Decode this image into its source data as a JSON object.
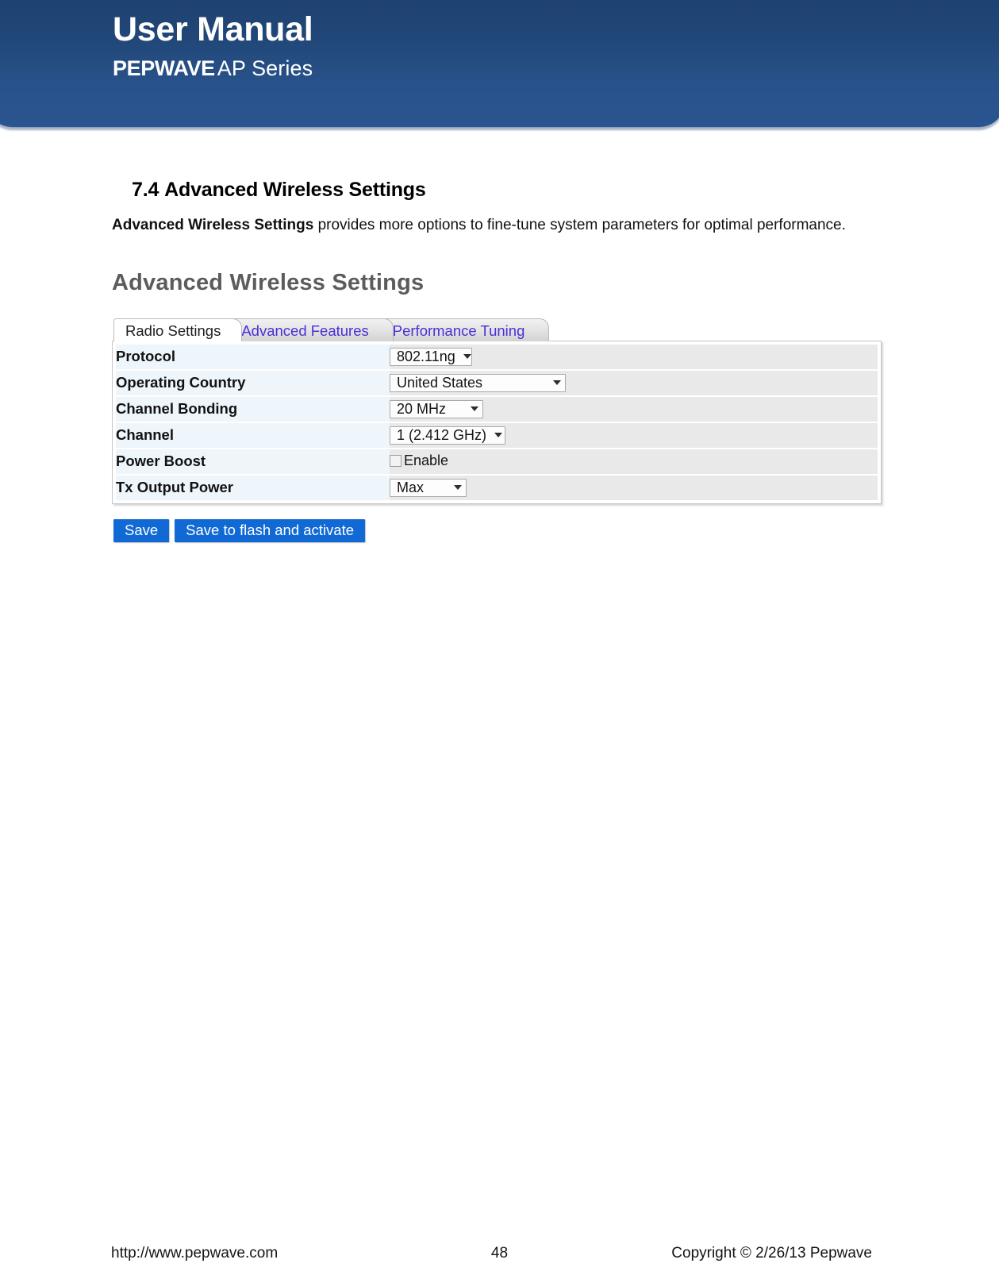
{
  "header": {
    "manual_title": "User Manual",
    "brand_bold": "PEPWAVE",
    "brand_regular": "AP Series",
    "banner_color": "#24497d"
  },
  "document": {
    "section_number": "7.4",
    "section_title": "Advanced Wireless Settings",
    "paragraph_bold": "Advanced Wireless Settings",
    "paragraph_rest": " provides more options to fine-tune system parameters for optimal performance."
  },
  "screenshot": {
    "title": "Advanced Wireless Settings",
    "tabs": [
      {
        "label": "Radio Settings",
        "active": true
      },
      {
        "label": "Advanced Features",
        "active": false
      },
      {
        "label": "Performance Tuning",
        "active": false
      }
    ],
    "tab_link_color": "#4a2fd8",
    "rows": [
      {
        "label": "Protocol",
        "control": "select",
        "value": "802.11ng"
      },
      {
        "label": "Operating Country",
        "control": "select",
        "value": "United States"
      },
      {
        "label": "Channel Bonding",
        "control": "select",
        "value": "20 MHz"
      },
      {
        "label": "Channel",
        "control": "select",
        "value": "1 (2.412 GHz)"
      },
      {
        "label": "Power Boost",
        "control": "checkbox",
        "value": "Enable",
        "checked": false
      },
      {
        "label": "Tx Output Power",
        "control": "select",
        "value": "Max"
      }
    ],
    "buttons": [
      {
        "label": "Save"
      },
      {
        "label": "Save to flash and activate"
      }
    ],
    "button_color": "#1069d4"
  },
  "footer": {
    "url": "http://www.pepwave.com",
    "page_number": "48",
    "copyright": "Copyright © 2/26/13 Pepwave"
  }
}
